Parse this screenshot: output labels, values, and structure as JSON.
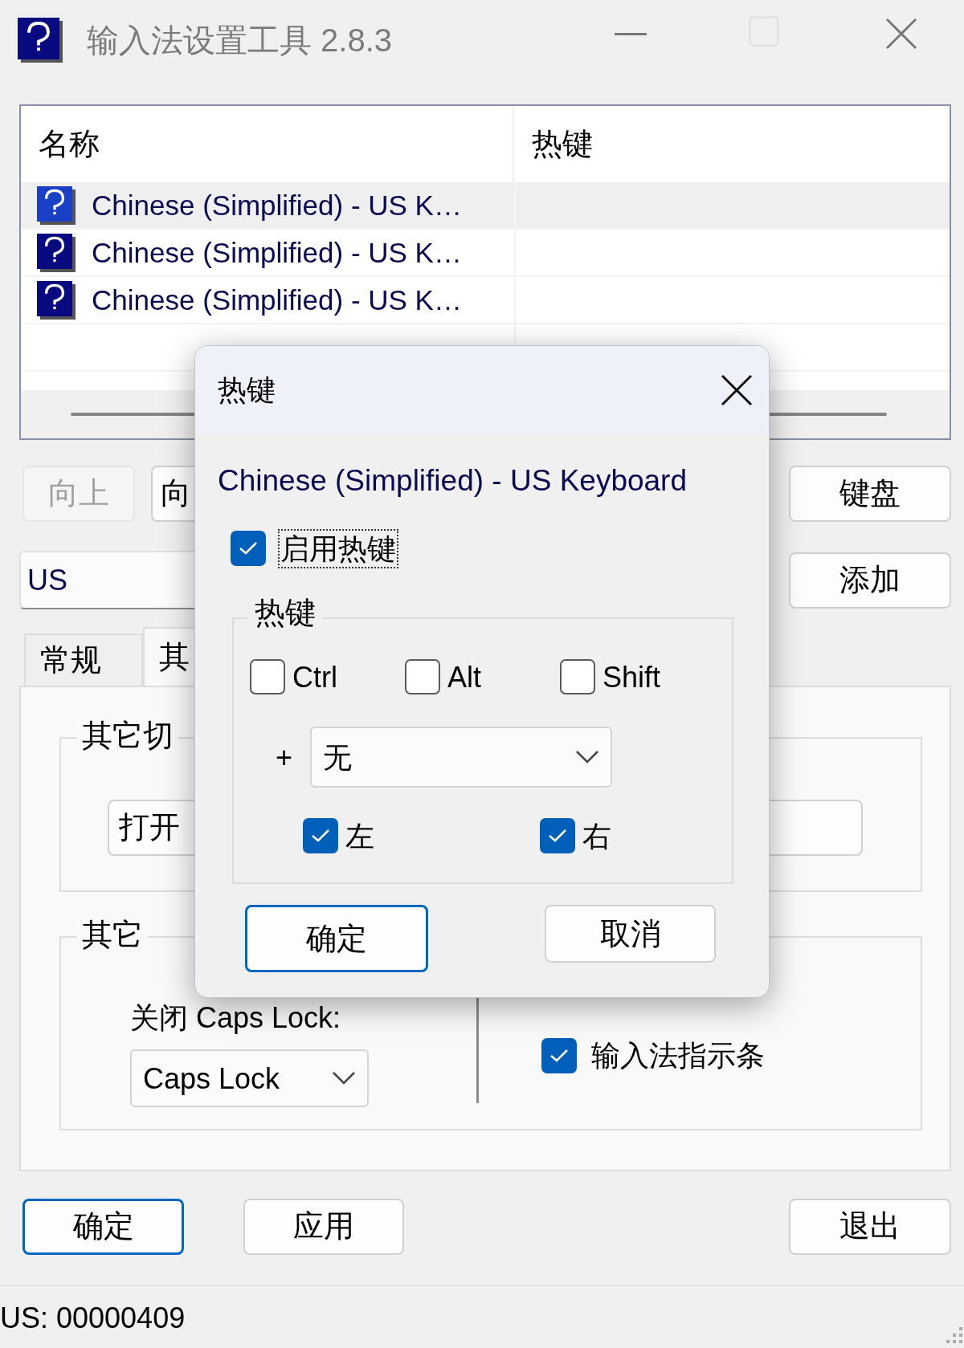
{
  "window": {
    "title": "输入法设置工具 2.8.3"
  },
  "list": {
    "columns": [
      "名称",
      "热键"
    ],
    "rows": [
      {
        "name": "Chinese (Simplified) - US K…",
        "selected": true
      },
      {
        "name": "Chinese (Simplified) - US K…",
        "selected": false
      },
      {
        "name": "Chinese (Simplified) - US K…",
        "selected": false
      }
    ]
  },
  "top_buttons": [
    {
      "label": "向上",
      "disabled": true
    },
    {
      "label": "向",
      "disabled": false
    },
    {
      "label": "键盘",
      "disabled": false
    }
  ],
  "layout_field": {
    "value": "US"
  },
  "add_button": {
    "label": "添加"
  },
  "tabs": [
    {
      "label": "常规",
      "selected": false
    },
    {
      "label": "其",
      "selected": true
    }
  ],
  "switch_group": {
    "title": "其它切",
    "button": "打开"
  },
  "other_group": {
    "title": "其它",
    "caps_label": "关闭 Caps Lock:",
    "caps_value": "Caps Lock",
    "indicator": {
      "label": "输入法指示条",
      "checked": true
    }
  },
  "bottom_buttons": [
    {
      "label": "确定",
      "default": true
    },
    {
      "label": "应用",
      "default": false
    },
    {
      "label": "退出",
      "default": false
    }
  ],
  "status_bar": {
    "text": "US: 00000409"
  },
  "dialog": {
    "title": "热键",
    "ime": "Chinese (Simplified) - US Keyboard",
    "enable": {
      "label": "启用热键",
      "checked": true,
      "focused": true
    },
    "group_title": "热键",
    "modifiers": [
      {
        "label": "Ctrl",
        "checked": false
      },
      {
        "label": "Alt",
        "checked": false
      },
      {
        "label": "Shift",
        "checked": false
      }
    ],
    "plus": "+",
    "key": {
      "value": "无"
    },
    "sides": [
      {
        "label": "左",
        "checked": true
      },
      {
        "label": "右",
        "checked": true
      }
    ],
    "buttons": [
      {
        "label": "确定",
        "default": true
      },
      {
        "label": "取消",
        "default": false
      }
    ]
  }
}
